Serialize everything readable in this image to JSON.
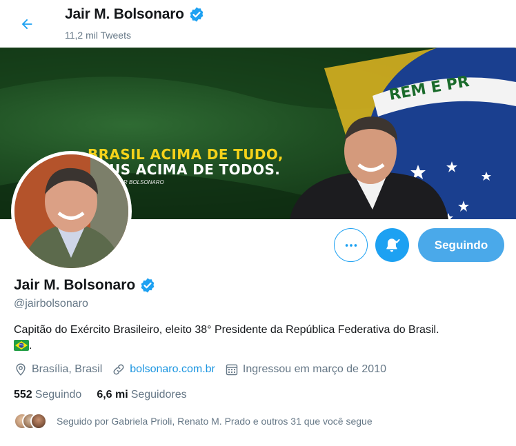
{
  "header": {
    "name": "Jair M. Bolsonaro",
    "tweet_count": "11,2 mil Tweets",
    "back_icon": "arrow-left-icon",
    "verified_icon": "verified-badge-icon"
  },
  "banner": {
    "line1": "BRASIL ACIMA DE TUDO,",
    "line2": "DEUS ACIMA DE TODOS.",
    "line3": "Presidente JAIR BOLSONARO",
    "flag_text": "EM E PR"
  },
  "actions": {
    "more_icon": "more-horizontal-icon",
    "bell_icon": "notifications-bell-icon",
    "follow_label": "Seguindo"
  },
  "profile": {
    "name": "Jair M. Bolsonaro",
    "handle": "@jairbolsonaro",
    "bio": "Capitão do Exército Brasileiro, eleito 38° Presidente da República Federativa do Brasil.",
    "bio_end": ".",
    "location": "Brasília, Brasil",
    "website": "bolsonaro.com.br",
    "joined": "Ingressou em março de 2010"
  },
  "counts": {
    "following_value": "552",
    "following_label": "Seguindo",
    "followers_value": "6,6 mi",
    "followers_label": "Seguidores"
  },
  "followed_by": "Seguido por Gabriela Prioli, Renato M. Prado e outros 31 que você segue",
  "colors": {
    "accent": "#1da1f2",
    "follow_button": "#4aa9ea",
    "link": "#1b95e0",
    "secondary_text": "#657786",
    "slogan_yellow": "#f5d21a"
  }
}
